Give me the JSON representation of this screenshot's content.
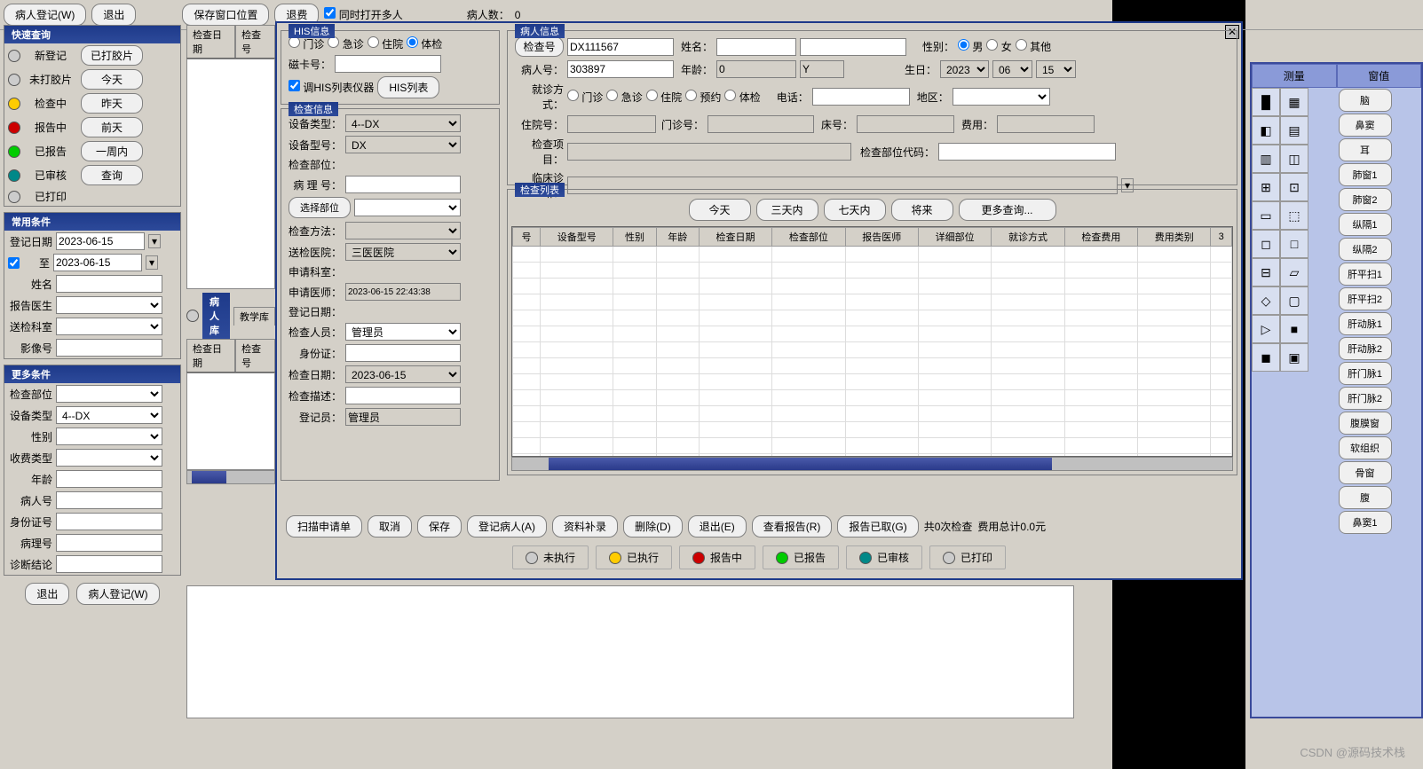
{
  "topbar": {
    "register": "病人登记(W)",
    "exit": "退出",
    "save_pos": "保存窗口位置",
    "refund": "退费",
    "multi_open": "同时打开多人",
    "patient_count_lbl": "病人数：",
    "patient_count": "0"
  },
  "quick_query": {
    "title": "快速查询",
    "items": [
      {
        "label": "新登记",
        "btn": "已打胶片",
        "color": "#ccc"
      },
      {
        "label": "未打胶片",
        "btn": "今天",
        "color": "#ccc"
      },
      {
        "label": "检查中",
        "btn": "昨天",
        "color": "#ffcc00"
      },
      {
        "label": "报告中",
        "btn": "前天",
        "color": "#cc0000"
      },
      {
        "label": "已报告",
        "btn": "一周内",
        "color": "#00cc00"
      },
      {
        "label": "已审核",
        "btn": "查询",
        "color": "#008888"
      },
      {
        "label": "已打印",
        "btn": "",
        "color": "#ccc"
      }
    ]
  },
  "common_cond": {
    "title": "常用条件",
    "reg_date_lbl": "登记日期",
    "reg_date": "2023-06-15",
    "to_lbl": "至",
    "to_date": "2023-06-15",
    "name_lbl": "姓名",
    "doctor_lbl": "报告医生",
    "dept_lbl": "送检科室",
    "image_lbl": "影像号"
  },
  "more_cond": {
    "title": "更多条件",
    "part_lbl": "检查部位",
    "device_lbl": "设备类型",
    "device_val": "4--DX",
    "gender_lbl": "性别",
    "fee_lbl": "收费类型",
    "age_lbl": "年龄",
    "pno_lbl": "病人号",
    "id_lbl": "身份证号",
    "caseno_lbl": "病理号",
    "diag_lbl": "诊断结论"
  },
  "bottom_btns": {
    "exit": "退出",
    "register": "病人登记(W)"
  },
  "mid_tabs": {
    "t1": "检查日期",
    "t2": "检查号",
    "lib": "病人库",
    "teach": "教学库"
  },
  "modal": {
    "his": {
      "title": "HIS信息",
      "outpatient": "门诊",
      "emergency": "急诊",
      "inpatient": "住院",
      "physical": "体检",
      "card_lbl": "磁卡号：",
      "his_list_chk": "调HIS列表仪器",
      "his_list_btn": "HIS列表"
    },
    "exam": {
      "title": "检查信息",
      "dev_type_lbl": "设备类型：",
      "dev_type": "4--DX",
      "dev_model_lbl": "设备型号：",
      "dev_model": "DX",
      "part_lbl": "检查部位：",
      "case_lbl": "病 理 号：",
      "select_part": "选择部位",
      "method_lbl": "检查方法：",
      "hospital_lbl": "送检医院：",
      "hospital": "三医医院",
      "apply_dept_lbl": "申请科室：",
      "apply_doc_lbl": "申请医师：",
      "apply_ts": "2023-06-15 22:43:38",
      "reg_date_lbl": "登记日期：",
      "examiner_lbl": "检查人员：",
      "examiner": "管理员",
      "idcard_lbl": "身份证：",
      "exam_date_lbl": "检查日期：",
      "exam_date": "2023-06-15",
      "desc_lbl": "检查描述：",
      "registrar_lbl": "登记员：",
      "registrar": "管理员"
    },
    "patient": {
      "title": "病人信息",
      "checkno_btn": "检查号",
      "checkno": "DX111567",
      "name_lbl": "姓名：",
      "gender_lbl": "性别：",
      "male": "男",
      "female": "女",
      "other": "其他",
      "pno_lbl": "病人号：",
      "pno": "303897",
      "age_lbl": "年龄：",
      "age": "0",
      "age_unit": "Y",
      "birth_lbl": "生日：",
      "by": "2023",
      "bm": "06",
      "bd": "15",
      "visit_lbl": "就诊方式：",
      "v1": "门诊",
      "v2": "急诊",
      "v3": "住院",
      "v4": "预约",
      "v5": "体检",
      "phone_lbl": "电话：",
      "region_lbl": "地区：",
      "admno_lbl": "住院号：",
      "outno_lbl": "门诊号：",
      "bed_lbl": "床号：",
      "fee_lbl": "费用：",
      "item_lbl": "检查项目：",
      "partcode_lbl": "检查部位代码：",
      "diag_lbl": "临床诊断："
    },
    "list": {
      "title": "检查列表",
      "today": "今天",
      "3d": "三天内",
      "7d": "七天内",
      "future": "将来",
      "more": "更多查询...",
      "cols": [
        "号",
        "设备型号",
        "性别",
        "年龄",
        "检查日期",
        "检查部位",
        "报告医师",
        "详细部位",
        "就诊方式",
        "检查费用",
        "费用类别",
        "3"
      ]
    },
    "btns": {
      "scan": "扫描申请单",
      "cancel": "取消",
      "save": "保存",
      "reg": "登记病人(A)",
      "supp": "资料补录",
      "del": "删除(D)",
      "exit": "退出(E)",
      "view": "查看报告(R)",
      "got": "报告已取(G)",
      "summary1": "共0次检查",
      "summary2": "费用总计0.0元"
    },
    "status": {
      "s1": "未执行",
      "s2": "已执行",
      "s3": "报告中",
      "s4": "已报告",
      "s5": "已审核",
      "s6": "已打印"
    }
  },
  "right": {
    "tab1": "测量",
    "tab2": "窗值",
    "presets": [
      "脑",
      "鼻窦",
      "耳",
      "肺窗1",
      "肺窗2",
      "纵隔1",
      "纵隔2",
      "肝平扫1",
      "肝平扫2",
      "肝动脉1",
      "肝动脉2",
      "肝门脉1",
      "肝门脉2",
      "腹膜窗",
      "软组织",
      "骨窗",
      "腹",
      "鼻窦1"
    ]
  },
  "watermark": "CSDN @源码技术栈"
}
